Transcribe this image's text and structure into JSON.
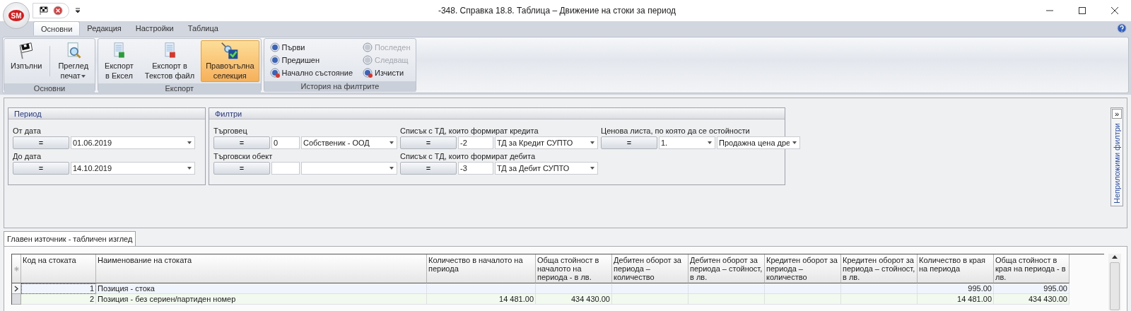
{
  "window": {
    "title": "-348. Справка 18.8. Таблица – Движение на стоки за период",
    "app_badge": "SM"
  },
  "ribbon_tabs": [
    {
      "label": "Основни",
      "selected": true
    },
    {
      "label": "Редакция",
      "selected": false
    },
    {
      "label": "Настройки",
      "selected": false
    },
    {
      "label": "Таблица",
      "selected": false
    }
  ],
  "ribbon_groups": [
    {
      "title": "Основни",
      "kind": "large",
      "buttons": [
        {
          "label": "Изпълни",
          "selected": false,
          "dropdown": false
        },
        {
          "label": "Преглед\nпечат",
          "selected": false,
          "dropdown": true
        }
      ]
    },
    {
      "title": "Експорт",
      "kind": "large",
      "buttons": [
        {
          "label": "Експорт\nв Ексел",
          "selected": false,
          "dropdown": false
        },
        {
          "label": "Експорт в\nТекстов файл",
          "selected": false,
          "dropdown": false
        },
        {
          "label": "Правоъгълна\nселекция",
          "selected": true,
          "dropdown": false
        }
      ]
    },
    {
      "title": "История на филтрите",
      "kind": "small",
      "buttons": [
        {
          "label": "Първи",
          "disabled": false
        },
        {
          "label": "Последен",
          "disabled": true
        },
        {
          "label": "Предишен",
          "disabled": false
        },
        {
          "label": "Следващ",
          "disabled": true
        },
        {
          "label": "Начално състояние",
          "disabled": false
        },
        {
          "label": "Изчисти",
          "disabled": false
        }
      ]
    }
  ],
  "period": {
    "title": "Период",
    "fields": [
      {
        "label": "От дата",
        "operator": "=",
        "value": "01.06.2019"
      },
      {
        "label": "До дата",
        "operator": "=",
        "value": "14.10.2019"
      }
    ]
  },
  "filters": {
    "title": "Филтри",
    "columns": [
      [
        {
          "label": "Търговец",
          "operator": "=",
          "kind": "code_combo",
          "code": "0",
          "value": "Собственик - ООД"
        },
        {
          "label": "Търговски обект",
          "operator": "=",
          "kind": "code_combo"
        }
      ],
      [
        {
          "label": "Списък с ТД, които формират кредита",
          "operator": "=",
          "kind": "code_combo",
          "code": "-2",
          "value": "ТД за Кредит СУПТО"
        },
        {
          "label": "Списък с ТД, които формират дебита",
          "operator": "=",
          "kind": "code_combo",
          "code": "-3",
          "value": "ТД за Дебит СУПТО"
        }
      ],
      [
        {
          "label": "Ценова листа, по която да се остойности",
          "operator": "=",
          "kind": "combo_combo",
          "code": "1.",
          "value": "Продажна цена дре"
        }
      ]
    ]
  },
  "side_panel": {
    "collapse": "»",
    "title": "Неприложими филтри"
  },
  "view_tab": {
    "label": "Главен източник - табличен изглед",
    "selected": true
  },
  "table": {
    "columns": [
      "Код на стоката",
      "Наименование на стоката",
      "Количество в началото на периода",
      "Обща стойност в началото на периода - в лв.",
      "Дебитен оборот за периода – количество",
      "Дебитен оборот за периода – стойност, в лв.",
      "Кредитен оборот за периода – количество",
      "Кредитен оборот за периода – стойност, в лв.",
      "Количество в края на периода",
      "Обща стойност в края на периода - в лв."
    ],
    "rows": [
      {
        "current": true,
        "cells": [
          "1",
          "Позиция - стока",
          null,
          null,
          null,
          null,
          null,
          null,
          "995.00",
          "995.00"
        ]
      },
      {
        "current": false,
        "cells": [
          "2",
          "Позиция - без сериен/партиден номер",
          "14 481.00",
          "434 430.00",
          null,
          null,
          null,
          null,
          "14 481.00",
          "434 430.00"
        ]
      }
    ]
  }
}
